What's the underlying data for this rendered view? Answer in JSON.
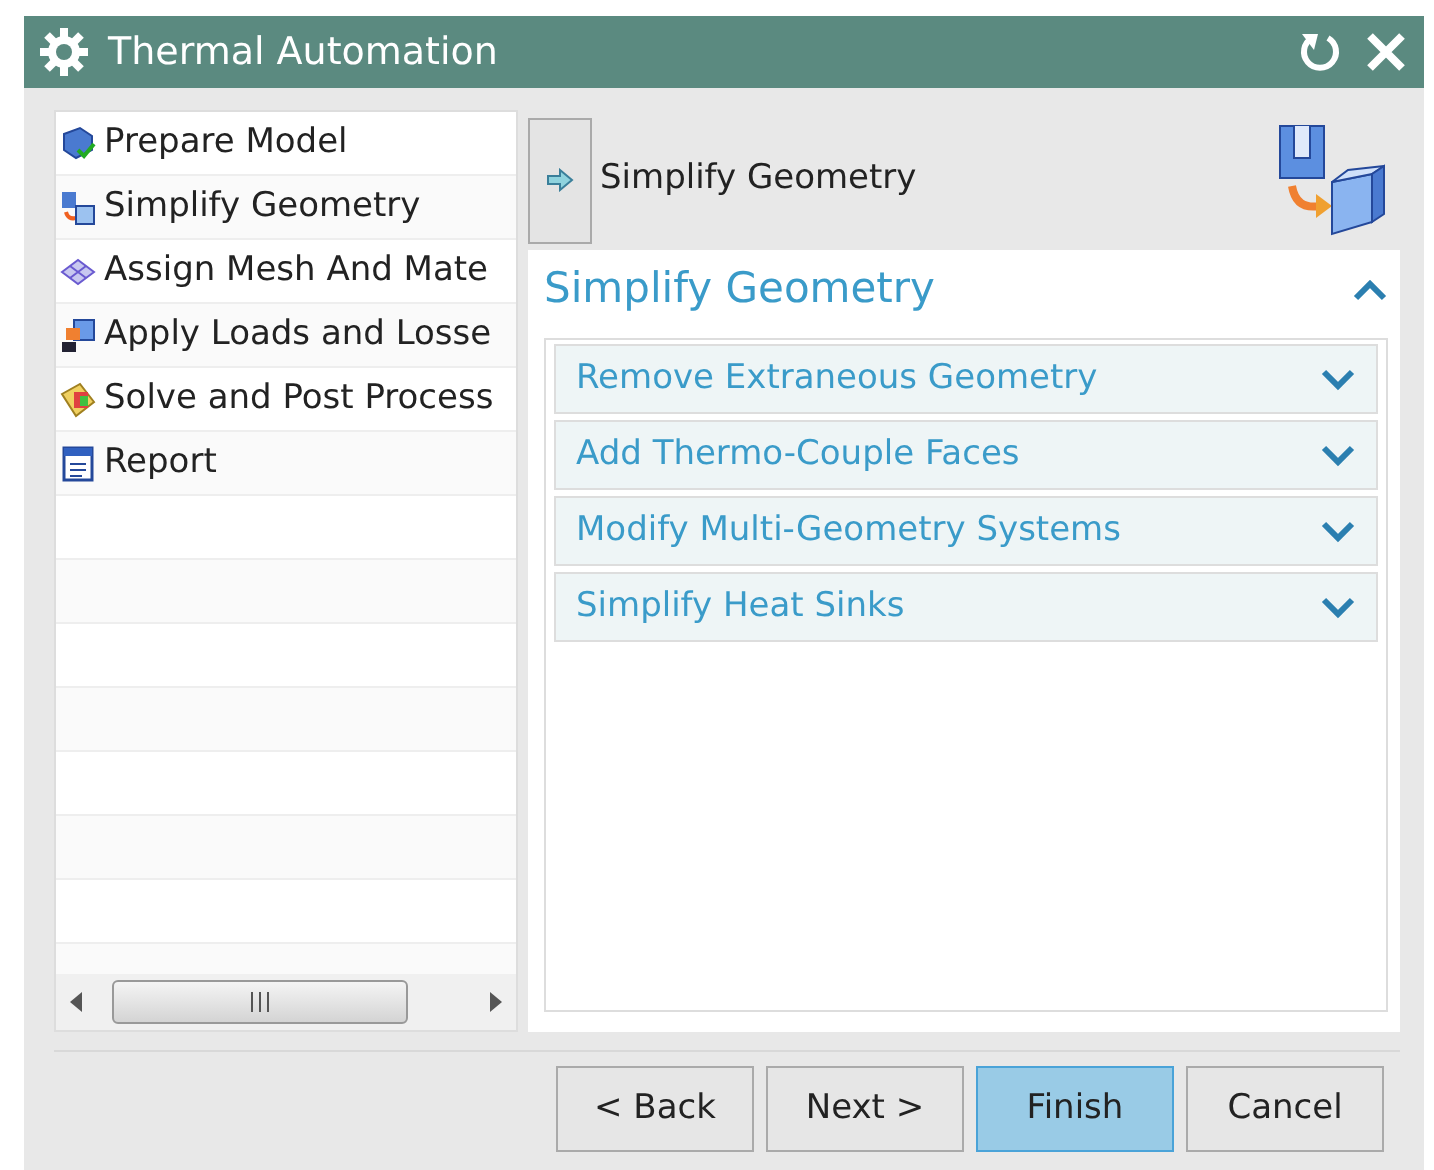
{
  "window": {
    "title": "Thermal Automation"
  },
  "steps": [
    {
      "label": "Prepare Model"
    },
    {
      "label": "Simplify Geometry"
    },
    {
      "label": "Assign Mesh And Mate"
    },
    {
      "label": "Apply Loads and Losse"
    },
    {
      "label": "Solve and Post Process"
    },
    {
      "label": "Report"
    }
  ],
  "current_step": {
    "label": "Simplify Geometry"
  },
  "section": {
    "title": "Simplify Geometry",
    "expanded": true,
    "groups": [
      {
        "label": "Remove Extraneous Geometry",
        "expanded": false
      },
      {
        "label": "Add Thermo-Couple Faces",
        "expanded": false
      },
      {
        "label": "Modify Multi-Geometry Systems",
        "expanded": false
      },
      {
        "label": "Simplify Heat Sinks",
        "expanded": false
      }
    ]
  },
  "buttons": [
    {
      "label": "< Back",
      "default": false
    },
    {
      "label": "Next >",
      "default": false
    },
    {
      "label": "Finish",
      "default": true
    },
    {
      "label": "Cancel",
      "default": false
    }
  ]
}
